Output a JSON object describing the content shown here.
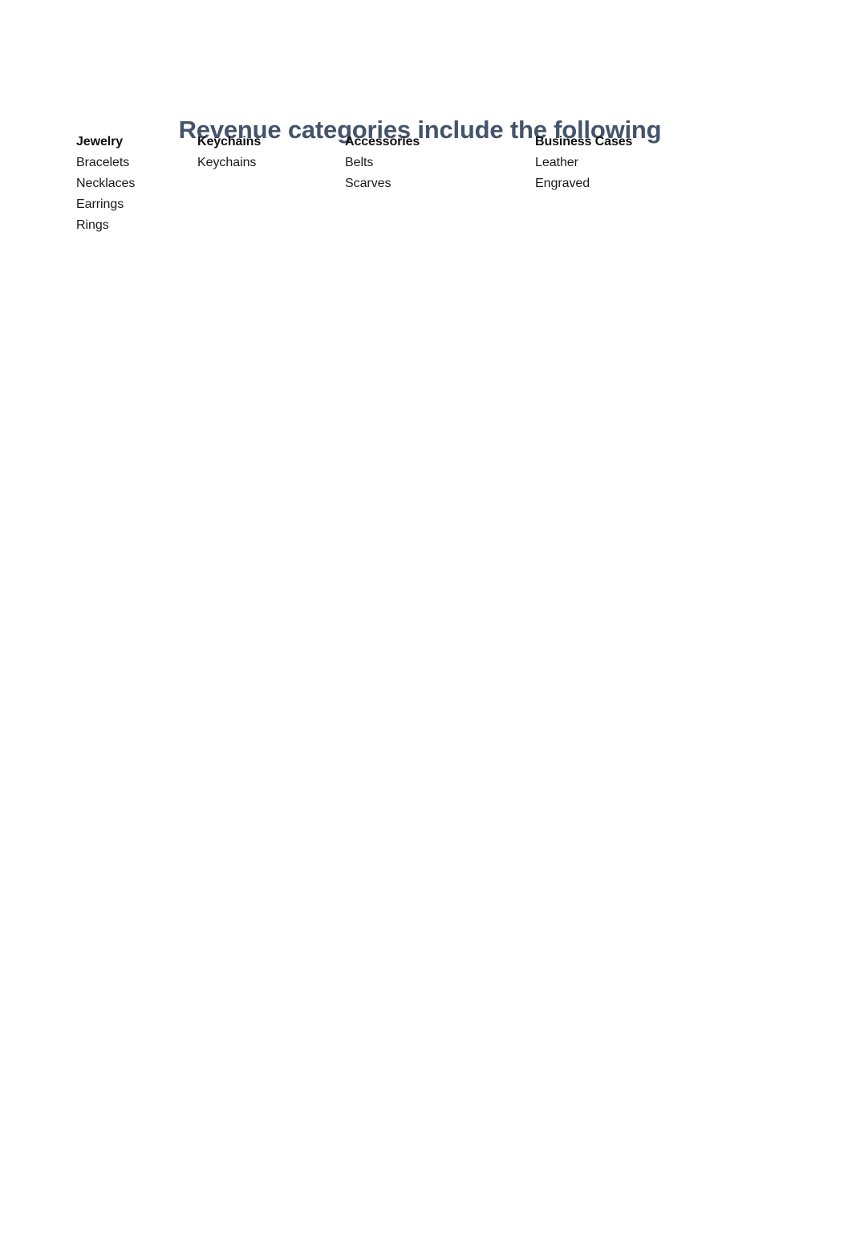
{
  "document": {
    "title": "Revenue categories include the following",
    "title_color": "#44546A",
    "background_color": "#FFFFFF",
    "body_text_color": "#1A1A1A"
  },
  "columns": [
    {
      "header": "Jewelry",
      "items": [
        "Bracelets",
        "Necklaces",
        "Earrings",
        "Rings"
      ]
    },
    {
      "header": "Keychains",
      "items": [
        "Keychains"
      ]
    },
    {
      "header": "Accessories",
      "items": [
        "Belts",
        "Scarves"
      ]
    },
    {
      "header": "Business Cases",
      "items": [
        "Leather",
        "Engraved"
      ]
    }
  ]
}
